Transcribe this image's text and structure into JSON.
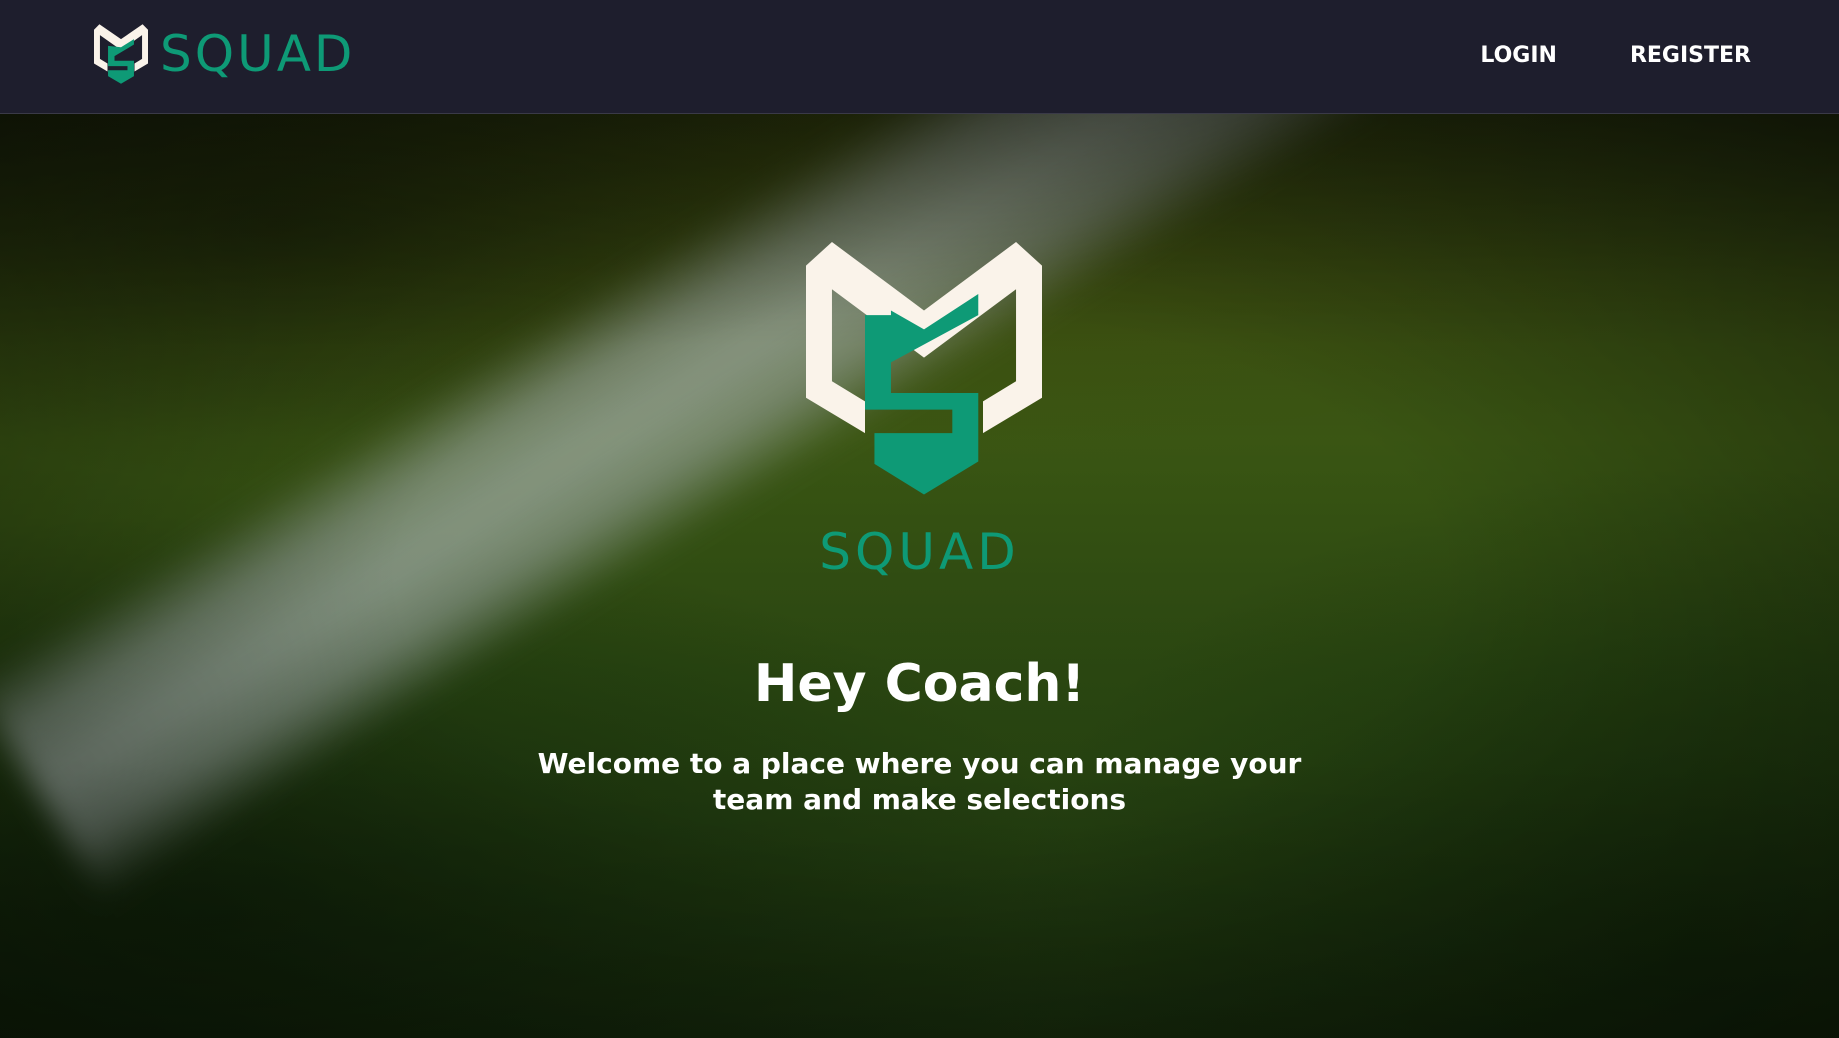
{
  "header": {
    "brand": "SQUAD",
    "nav": {
      "login_label": "LOGIN",
      "register_label": "REGISTER"
    }
  },
  "hero": {
    "brand": "SQUAD",
    "title": "Hey Coach!",
    "subtitle": "Welcome to a place where you can manage your team and make selections"
  },
  "colors": {
    "navbar_bg": "#1e1e2d",
    "brand_green": "#0e9a76",
    "logo_cream": "#faf3ea",
    "text_white": "#ffffff"
  },
  "icons": {
    "nav_logo": "squad-shield-logo-icon",
    "hero_logo": "squad-shield-logo-icon"
  }
}
